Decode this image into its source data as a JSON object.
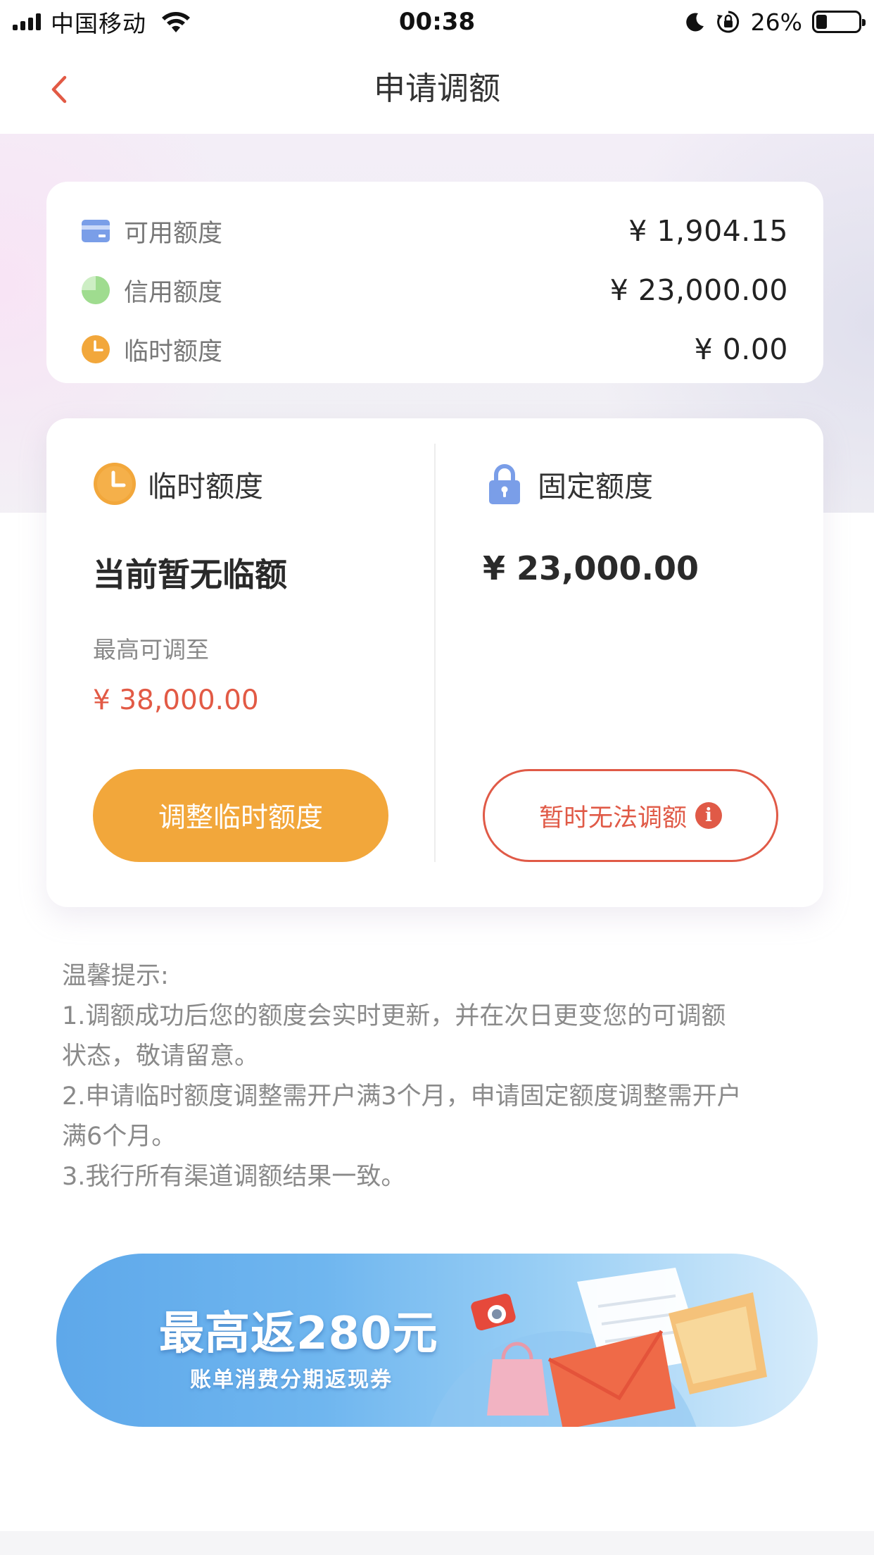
{
  "status_bar": {
    "carrier": "中国移动",
    "time": "00:38",
    "battery_percent": "26%",
    "battery_level": 0.26
  },
  "nav": {
    "title": "申请调额"
  },
  "summary": {
    "items": [
      {
        "label": "可用额度",
        "value": "¥ 1,904.15",
        "icon": "credit-card-icon",
        "color": "#7a9ee8"
      },
      {
        "label": "信用额度",
        "value": "¥ 23,000.00",
        "icon": "pie-chart-icon",
        "color": "#9fdc8f"
      },
      {
        "label": "临时额度",
        "value": "¥ 0.00",
        "icon": "clock-icon",
        "color": "#f2a73b"
      }
    ]
  },
  "temp_limit": {
    "title": "临时额度",
    "status": "当前暂无临额",
    "max_label": "最高可调至",
    "max_amount": "¥ 38,000.00",
    "button_label": "调整临时额度"
  },
  "fixed_limit": {
    "title": "固定额度",
    "amount": "¥ 23,000.00",
    "button_label": "暂时无法调额"
  },
  "tips": {
    "heading": "温馨提示:",
    "line1": "1.调额成功后您的额度会实时更新，并在次日更变您的可调额",
    "line2": "状态，敬请留意。",
    "line3": "2.申请临时额度调整需开户满3个月，申请固定额度调整需开户",
    "line4": "满6个月。",
    "line5": "3.我行所有渠道调额结果一致。"
  },
  "banner": {
    "title": "最高返280元",
    "subtitle": "账单消费分期返现券"
  },
  "colors": {
    "accent_red": "#e25a45",
    "accent_orange": "#f2a73b",
    "lock_blue": "#7a9ee8"
  }
}
